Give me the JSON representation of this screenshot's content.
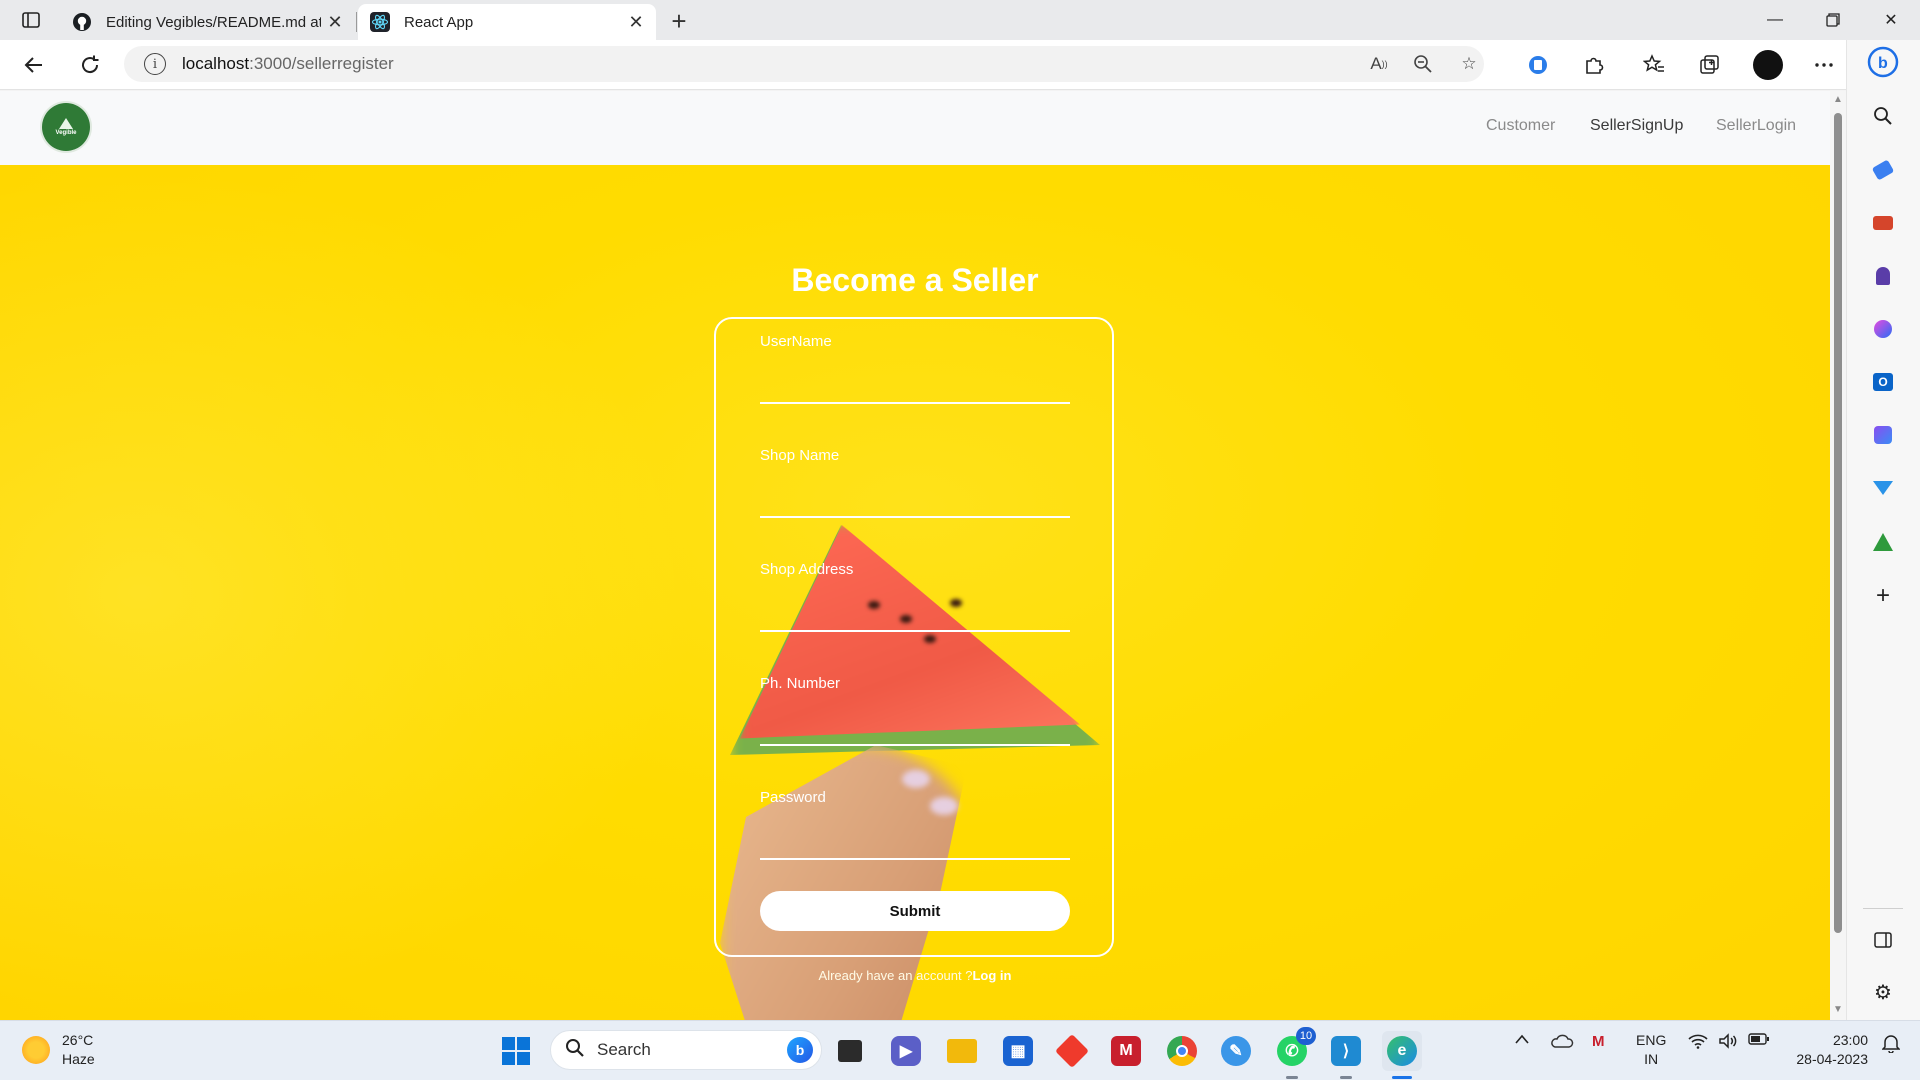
{
  "browser": {
    "tabs": [
      {
        "title": "Editing Vegibles/README.md at",
        "active": false,
        "favicon": "github-icon"
      },
      {
        "title": "React App",
        "active": true,
        "favicon": "react-icon"
      }
    ],
    "address": {
      "host": "localhost",
      "path": ":3000/sellerregister"
    }
  },
  "site": {
    "logo_text": "Vegible",
    "nav": {
      "customer": "Customer",
      "seller_signup": "SellerSignUp",
      "seller_login": "SellerLogin"
    },
    "active_nav": "SellerSignUp"
  },
  "form": {
    "title": "Become a Seller",
    "fields": [
      {
        "label": "UserName",
        "value": ""
      },
      {
        "label": "Shop Name",
        "value": ""
      },
      {
        "label": "Shop Address",
        "value": ""
      },
      {
        "label": "Ph. Number",
        "value": ""
      },
      {
        "label": "Password",
        "value": ""
      }
    ],
    "submit_label": "Submit",
    "already_text": "Already have an account ?",
    "login_link": "Log in"
  },
  "colors": {
    "page_bg": "#ffd800",
    "navbar_bg": "#f8f9fa",
    "logo_green": "#2f7a36"
  },
  "taskbar": {
    "weather": {
      "temp": "26°C",
      "condition": "Haze"
    },
    "search_placeholder": "Search",
    "whatsapp_badge": "10",
    "lang": {
      "line1": "ENG",
      "line2": "IN"
    },
    "clock": {
      "time": "23:00",
      "date": "28-04-2023"
    }
  }
}
